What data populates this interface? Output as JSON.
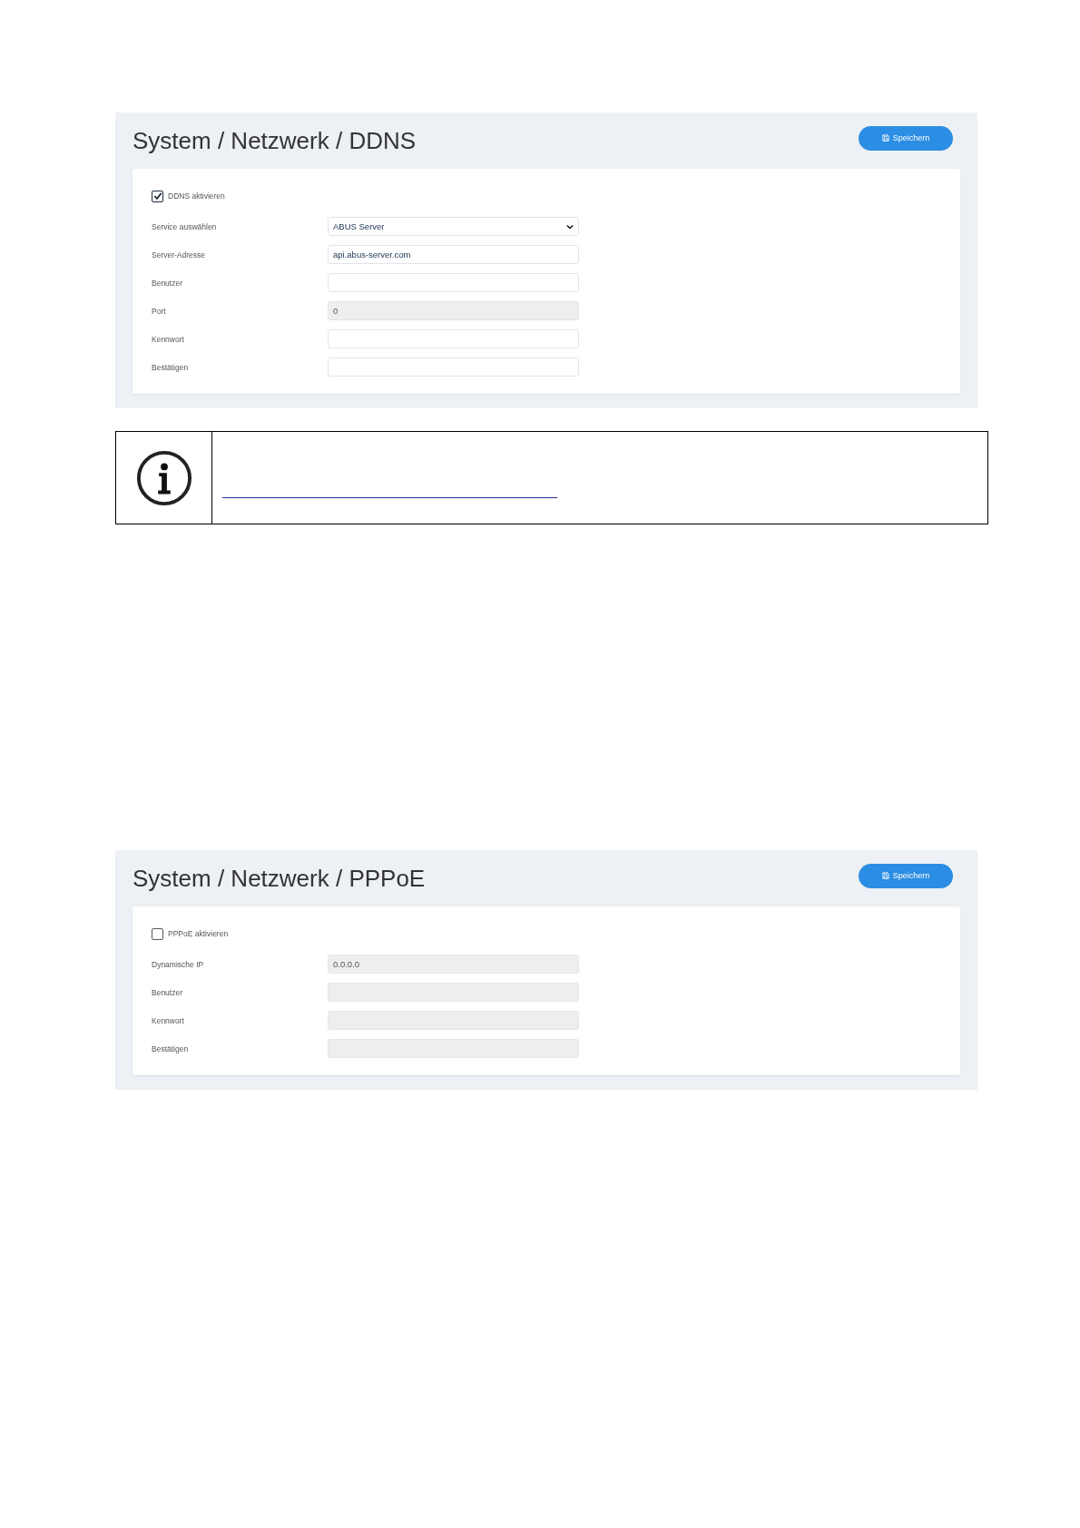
{
  "panels": [
    {
      "title": "System / Netzwerk / DDNS",
      "save_button": "Speichern",
      "enable": {
        "label": "DDNS aktivieren",
        "checked": true
      },
      "fields": [
        {
          "label": "Service auswählen",
          "kind": "select",
          "value": "ABUS Server",
          "disabled": false
        },
        {
          "label": "Server-Adresse",
          "kind": "input",
          "value": "api.abus-server.com",
          "disabled": false
        },
        {
          "label": "Benutzer",
          "kind": "input",
          "disabled": false
        },
        {
          "label": "Port",
          "kind": "input",
          "value": "0",
          "disabled": true
        },
        {
          "label": "Kennwort",
          "kind": "input",
          "disabled": false
        },
        {
          "label": "Bestätigen",
          "kind": "input",
          "disabled": false
        }
      ]
    },
    {
      "title": "System / Netzwerk / PPPoE",
      "save_button": "Speichern",
      "enable": {
        "label": "PPPoE aktivieren",
        "checked": false
      },
      "fields": [
        {
          "label": "Dynamische IP",
          "kind": "input",
          "value": "0.0.0.0",
          "disabled": true
        },
        {
          "label": "Benutzer",
          "kind": "input",
          "disabled": true
        },
        {
          "label": "Kennwort",
          "kind": "input",
          "disabled": true
        },
        {
          "label": "Bestätigen",
          "kind": "input",
          "disabled": true
        }
      ]
    }
  ],
  "info_box": {
    "kind": "info"
  }
}
